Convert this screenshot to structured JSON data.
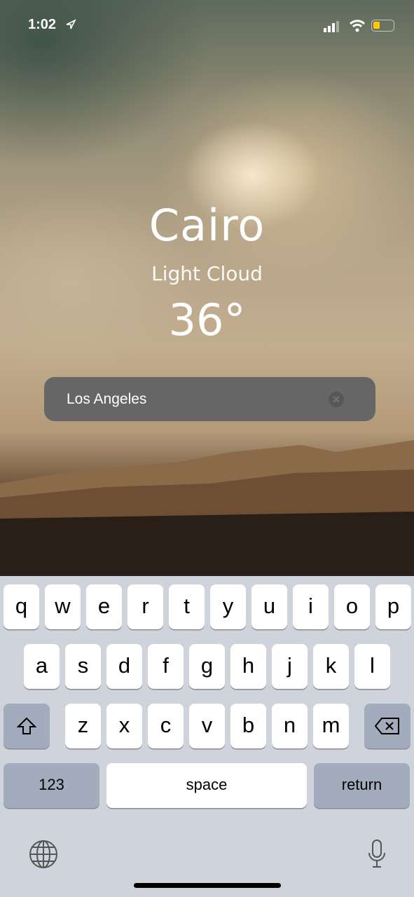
{
  "status_bar": {
    "time": "1:02",
    "battery_color": "#ffcc00"
  },
  "weather": {
    "city": "Cairo",
    "condition": "Light Cloud",
    "temperature": "36°"
  },
  "search": {
    "value": "Los Angeles"
  },
  "keyboard": {
    "row1": [
      "q",
      "w",
      "e",
      "r",
      "t",
      "y",
      "u",
      "i",
      "o",
      "p"
    ],
    "row2": [
      "a",
      "s",
      "d",
      "f",
      "g",
      "h",
      "j",
      "k",
      "l"
    ],
    "row3": [
      "z",
      "x",
      "c",
      "v",
      "b",
      "n",
      "m"
    ],
    "numbers_label": "123",
    "space_label": "space",
    "return_label": "return"
  }
}
